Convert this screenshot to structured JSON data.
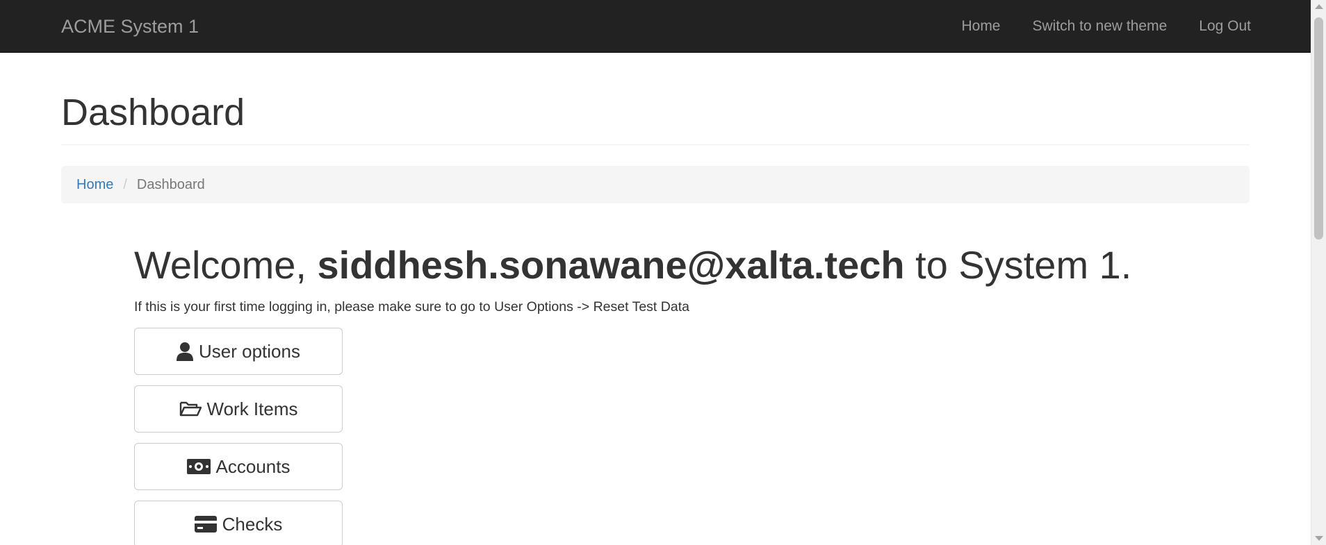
{
  "navbar": {
    "brand": "ACME System 1",
    "links": [
      {
        "label": "Home"
      },
      {
        "label": "Switch to new theme"
      },
      {
        "label": "Log Out"
      }
    ]
  },
  "page": {
    "title": "Dashboard"
  },
  "breadcrumb": {
    "home": "Home",
    "separator": "/",
    "current": "Dashboard"
  },
  "welcome": {
    "prefix": "Welcome, ",
    "user": "siddhesh.sonawane@xalta.tech",
    "suffix": " to System 1.",
    "intro": "If this is your first time logging in, please make sure to go to User Options -> Reset Test Data"
  },
  "menu": [
    {
      "label": "User options",
      "icon": "user-icon"
    },
    {
      "label": "Work Items",
      "icon": "folder-open-icon"
    },
    {
      "label": "Accounts",
      "icon": "money-icon"
    },
    {
      "label": "Checks",
      "icon": "credit-card-icon"
    }
  ],
  "colors": {
    "navbar_bg": "#222222",
    "navbar_text": "#9d9d9d",
    "link": "#337ab7",
    "breadcrumb_bg": "#f5f5f5"
  }
}
